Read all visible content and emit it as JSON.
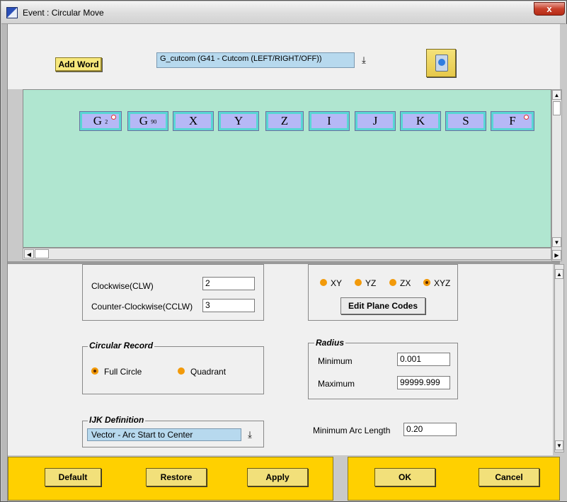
{
  "window": {
    "title": "Event : Circular Move",
    "close_glyph": "x"
  },
  "top": {
    "add_word_label": "Add Word",
    "word_select_value": "G_cutcom (G41 - Cutcom (LEFT/RIGHT/OFF))",
    "word_select_arrow": "⤓",
    "trash_icon": "recycle-bin-icon"
  },
  "words": [
    {
      "label": "G",
      "sub": "2",
      "dot": true
    },
    {
      "label": "G",
      "sub": "90",
      "dot": false
    },
    {
      "label": "X",
      "sub": "",
      "dot": false
    },
    {
      "label": "Y",
      "sub": "",
      "dot": false
    },
    {
      "label": "Z",
      "sub": "",
      "dot": false
    },
    {
      "label": "I",
      "sub": "",
      "dot": false
    },
    {
      "label": "J",
      "sub": "",
      "dot": false
    },
    {
      "label": "K",
      "sub": "",
      "dot": false
    },
    {
      "label": "S",
      "sub": "",
      "dot": false
    },
    {
      "label": "F",
      "sub": "",
      "dot": true
    }
  ],
  "direction": {
    "clw_label": "Clockwise(CLW)",
    "clw_value": "2",
    "cclw_label": "Counter-Clockwise(CCLW)",
    "cclw_value": "3"
  },
  "plane": {
    "options": [
      "XY",
      "YZ",
      "ZX",
      "XYZ"
    ],
    "selected": "XYZ",
    "edit_button": "Edit Plane Codes"
  },
  "circular_record": {
    "title": "Circular Record",
    "options": [
      "Full Circle",
      "Quadrant"
    ],
    "selected": "Full Circle"
  },
  "radius": {
    "title": "Radius",
    "min_label": "Minimum",
    "min_value": "0.001",
    "max_label": "Maximum",
    "max_value": "99999.999"
  },
  "ijk": {
    "title": "IJK Definition",
    "value": "Vector - Arc Start to Center",
    "arrow": "⤓"
  },
  "min_arc": {
    "label": "Minimum Arc Length",
    "value": "0.20"
  },
  "footer": {
    "default": "Default",
    "restore": "Restore",
    "apply": "Apply",
    "ok": "OK",
    "cancel": "Cancel"
  },
  "colors": {
    "accent_yellow": "#ffd000",
    "tile_fill": "#b6b8f6",
    "tile_border": "#59d6d4",
    "canvas": "#b0e6d0",
    "radio": "#f29a0a"
  }
}
